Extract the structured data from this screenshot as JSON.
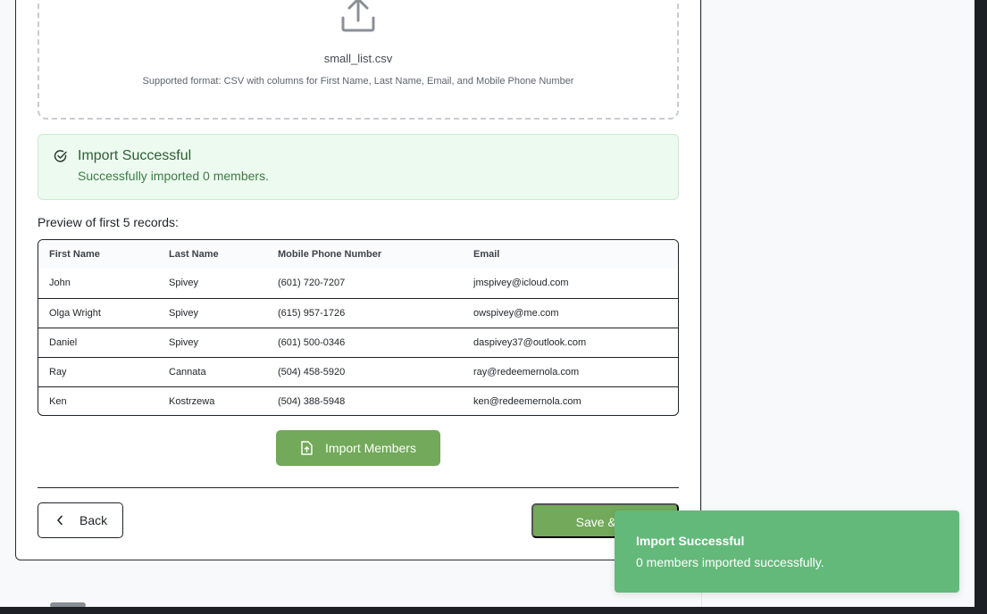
{
  "upload": {
    "icon": "upload-icon",
    "file_name": "small_list.csv",
    "format_note": "Supported format: CSV with columns for First Name, Last Name, Email, and Mobile Phone Number"
  },
  "alert": {
    "icon": "check-circle-icon",
    "title": "Import Successful",
    "message": "Successfully imported 0 members.",
    "color": "#ecfaf0"
  },
  "preview": {
    "heading": "Preview of first 5 records:",
    "columns": [
      "First Name",
      "Last Name",
      "Mobile Phone Number",
      "Email"
    ],
    "rows": [
      [
        "John",
        "Spivey",
        "(601) 720-7207",
        "jmspivey@icloud.com"
      ],
      [
        "Olga Wright",
        "Spivey",
        "(615) 957-1726",
        "owspivey@me.com"
      ],
      [
        "Daniel",
        "Spivey",
        "(601) 500-0346",
        "daspivey37@outlook.com"
      ],
      [
        "Ray",
        "Cannata",
        "(504) 458-5920",
        "ray@redeemernola.com"
      ],
      [
        "Ken",
        "Kostrzewa",
        "(504) 388-5948",
        "ken@redeemernola.com"
      ]
    ]
  },
  "actions": {
    "import_label": "Import Members",
    "import_icon": "file-upload-icon",
    "back_label": "Back",
    "back_icon": "chevron-left-icon",
    "save_label": "Save & Conti",
    "accent_color": "#72a95a"
  },
  "toast": {
    "title": "Import Successful",
    "message": "0 members imported successfully.",
    "color": "#63b97a"
  }
}
